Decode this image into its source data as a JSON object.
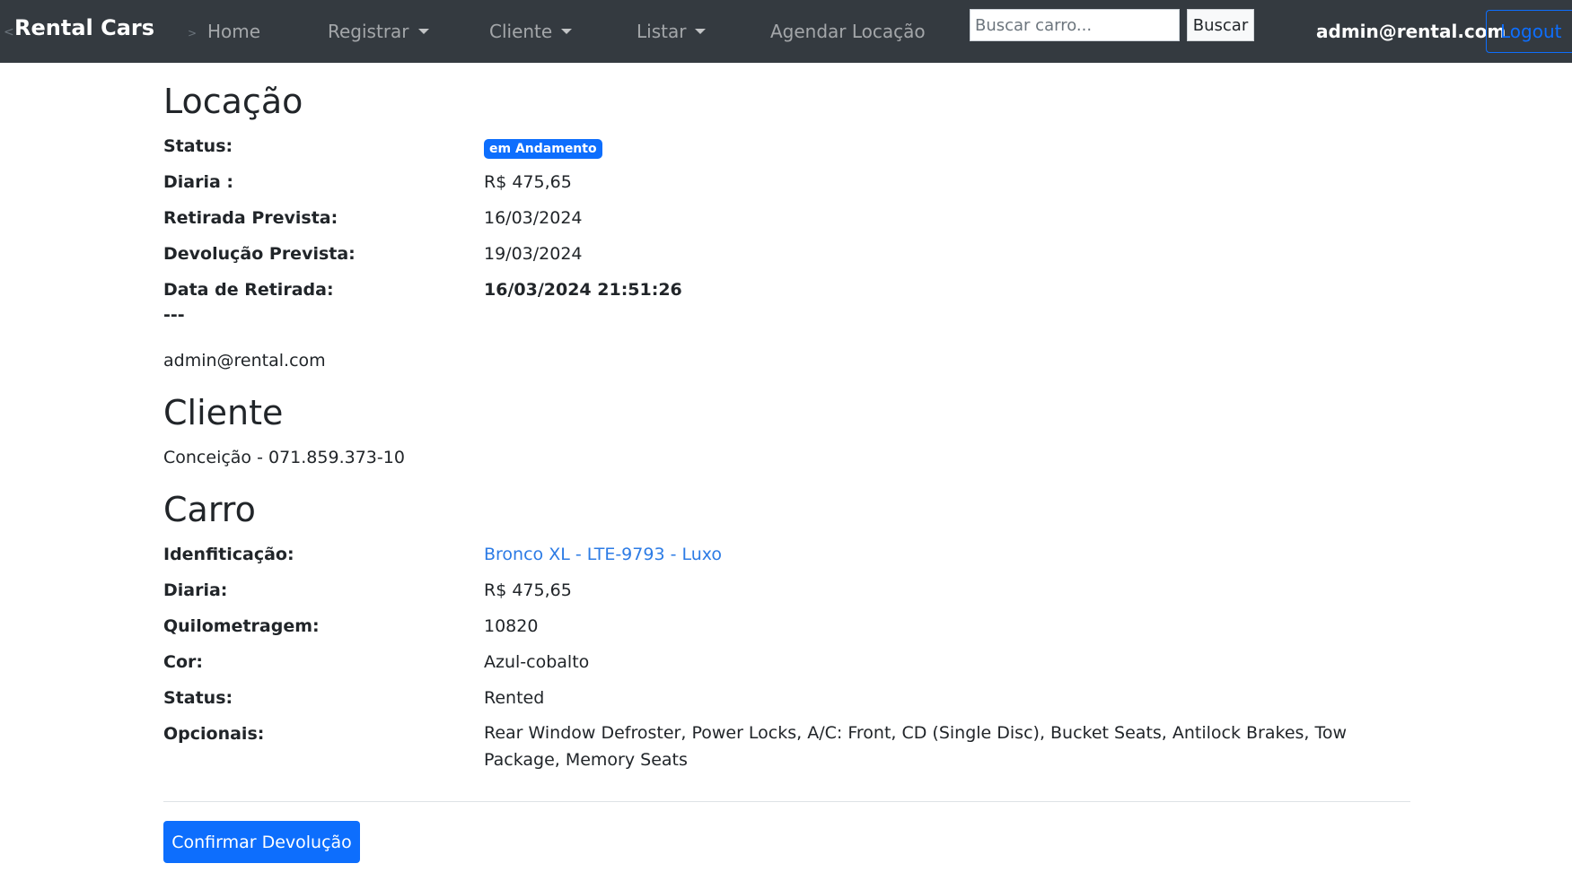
{
  "nav": {
    "edge_mark": "<",
    "brand": "Rental Cars",
    "home_mark": ">",
    "items": {
      "home": "Home",
      "registrar": "Registrar",
      "cliente": "Cliente",
      "listar": "Listar",
      "agendar": "Agendar Locação"
    },
    "search_placeholder": "Buscar carro...",
    "search_button": "Buscar",
    "user_email": "admin@rental.com",
    "logout": "Logout"
  },
  "locacao": {
    "title": "Locação",
    "status_label": "Status:",
    "status_badge": "em Andamento",
    "diaria_label": "Diaria :",
    "diaria_value": "R$ 475,65",
    "retirada_prevista_label": "Retirada Prevista:",
    "retirada_prevista_value": "16/03/2024",
    "devolucao_prevista_label": "Devolução Prevista:",
    "devolucao_prevista_value": "19/03/2024",
    "data_retirada_label": "Data de Retirada:",
    "data_retirada_value": "16/03/2024 21:51:26",
    "separator": "---",
    "responsavel": "admin@rental.com"
  },
  "cliente": {
    "title": "Cliente",
    "info": "Conceição - 071.859.373-10"
  },
  "carro": {
    "title": "Carro",
    "identificacao_label": "Idenfiticação:",
    "identificacao_value": "Bronco XL - LTE-9793 - Luxo",
    "diaria_label": "Diaria:",
    "diaria_value": "R$ 475,65",
    "quilometragem_label": "Quilometragem:",
    "quilometragem_value": "10820",
    "cor_label": "Cor:",
    "cor_value": "Azul-cobalto",
    "status_label": "Status:",
    "status_value": "Rented",
    "opcionais_label": "Opcionais:",
    "opcionais_value": "Rear Window Defroster, Power Locks, A/C: Front, CD (Single Disc), Bucket Seats, Antilock Brakes, Tow Package, Memory Seats"
  },
  "actions": {
    "confirm_button": "Confirmar Devolução"
  },
  "colors": {
    "navbar_bg": "#343a40",
    "primary": "#0d6efd",
    "link": "#2c7be5"
  }
}
